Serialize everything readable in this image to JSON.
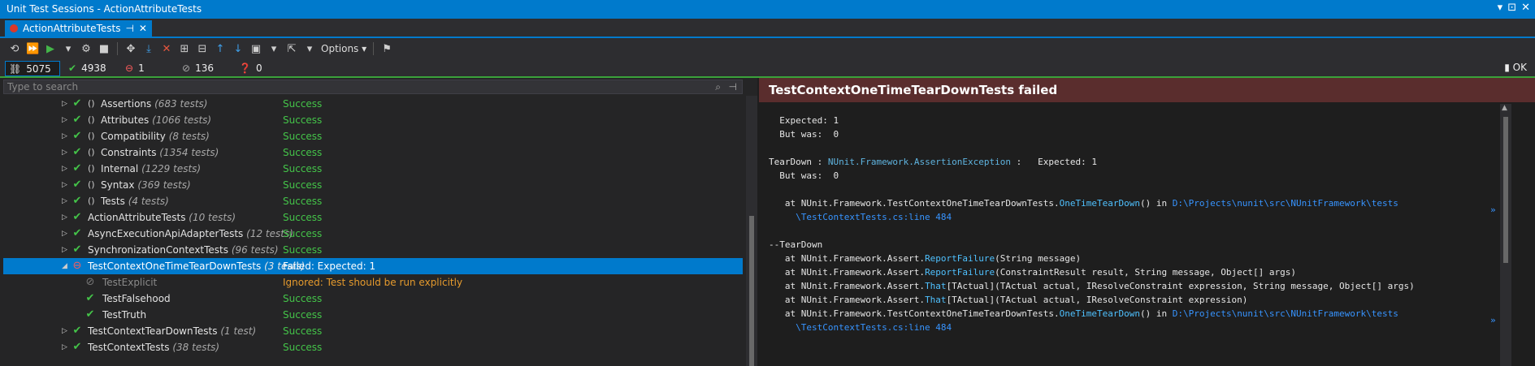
{
  "window": {
    "title": "Unit Test Sessions - ActionAttributeTests"
  },
  "tab": {
    "label": "ActionAttributeTests",
    "pin": "⊣",
    "close": "✕"
  },
  "toolbar": {
    "options_label": "Options"
  },
  "stats": {
    "total": "5075",
    "passed": "4938",
    "failed": "1",
    "ignored": "136",
    "unknown": "0",
    "status": "OK"
  },
  "search": {
    "placeholder": "Type to search"
  },
  "tree": [
    {
      "name": "Assertions",
      "count": "(683 tests)",
      "status": "Success",
      "kind": "ns"
    },
    {
      "name": "Attributes",
      "count": "(1066 tests)",
      "status": "Success",
      "kind": "ns"
    },
    {
      "name": "Compatibility",
      "count": "(8 tests)",
      "status": "Success",
      "kind": "ns"
    },
    {
      "name": "Constraints",
      "count": "(1354 tests)",
      "status": "Success",
      "kind": "ns"
    },
    {
      "name": "Internal",
      "count": "(1229 tests)",
      "status": "Success",
      "kind": "ns"
    },
    {
      "name": "Syntax",
      "count": "(369 tests)",
      "status": "Success",
      "kind": "ns"
    },
    {
      "name": "Tests",
      "count": "(4 tests)",
      "status": "Success",
      "kind": "ns"
    },
    {
      "name": "ActionAttributeTests",
      "count": "(10 tests)",
      "status": "Success",
      "kind": "cls"
    },
    {
      "name": "AsyncExecutionApiAdapterTests",
      "count": "(12 tests)",
      "status": "Success",
      "kind": "cls"
    },
    {
      "name": "SynchronizationContextTests",
      "count": "(96 tests)",
      "status": "Success",
      "kind": "cls"
    },
    {
      "name": "TestContextOneTimeTearDownTests",
      "count": "(3 tests)",
      "status": "Failed:   Expected: 1",
      "kind": "failed"
    },
    {
      "name": "TestExplicit",
      "count": "",
      "status": "Ignored: Test should be run explicitly",
      "kind": "ignored"
    },
    {
      "name": "TestFalsehood",
      "count": "",
      "status": "Success",
      "kind": "child"
    },
    {
      "name": "TestTruth",
      "count": "",
      "status": "Success",
      "kind": "child"
    },
    {
      "name": "TestContextTearDownTests",
      "count": "(1 test)",
      "status": "Success",
      "kind": "cls"
    },
    {
      "name": "TestContextTests",
      "count": "(38 tests)",
      "status": "Success",
      "kind": "cls"
    }
  ],
  "result": {
    "header": "TestContextOneTimeTearDownTests failed",
    "expected": "  Expected: 1",
    "but_was": "  But was:  0",
    "td_prefix": "TearDown : ",
    "td_cls": "NUnit.Framework.AssertionException",
    "td_suffix": " :   Expected: 1",
    "but_was2": "  But was:  0",
    "at1_pre": "   at NUnit.Framework.TestContextOneTimeTearDownTests.",
    "at1_mth": "OneTimeTearDown",
    "at1_mid": "() in ",
    "at1_path": "D:\\Projects\\nunit\\src\\NUnitFramework\\tests",
    "at1_path2": "     \\TestContextTests.cs:line 484",
    "sep": "--TearDown",
    "s1_pre": "   at NUnit.Framework.Assert.",
    "s1_mth": "ReportFailure",
    "s1_args": "(String message)",
    "s2_pre": "   at NUnit.Framework.Assert.",
    "s2_mth": "ReportFailure",
    "s2_args": "(ConstraintResult result, String message, Object[] args)",
    "s3_pre": "   at NUnit.Framework.Assert.",
    "s3_mth": "That",
    "s3_args": "[TActual](TActual actual, IResolveConstraint expression, String message, Object[] args)",
    "s4_pre": "   at NUnit.Framework.Assert.",
    "s4_mth": "That",
    "s4_args": "[TActual](TActual actual, IResolveConstraint expression)",
    "s5_pre": "   at NUnit.Framework.TestContextOneTimeTearDownTests.",
    "s5_mth": "OneTimeTearDown",
    "s5_mid": "() in ",
    "s5_path": "D:\\Projects\\nunit\\src\\NUnitFramework\\tests",
    "s5_path2": "     \\TestContextTests.cs:line 484",
    "overflow": "»"
  }
}
